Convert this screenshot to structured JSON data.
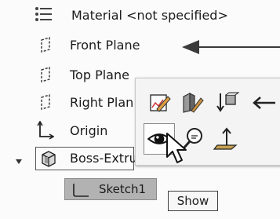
{
  "tree": {
    "material_label": "Material <not specified>",
    "front_plane_label": "Front Plane",
    "top_plane_label": "Top Plane",
    "right_plane_label": "Right Plan",
    "origin_label": "Origin",
    "boss_extrude_label": "Boss-Extru",
    "sketch_label": "Sketch1"
  },
  "tooltip": {
    "text": "Show"
  },
  "context_toolbar": {
    "buttons": [
      "edit-feature-icon",
      "edit-sketch-icon",
      "rollback-icon",
      "arrow-left-icon",
      "show-eye-icon",
      "zoom-to-selection-icon",
      "normal-to-icon"
    ],
    "highlighted": "show-eye-icon"
  },
  "colors": {
    "background": "#fbfbfb",
    "selected_row": "#b2b2b2",
    "text": "#1b1b1b"
  }
}
